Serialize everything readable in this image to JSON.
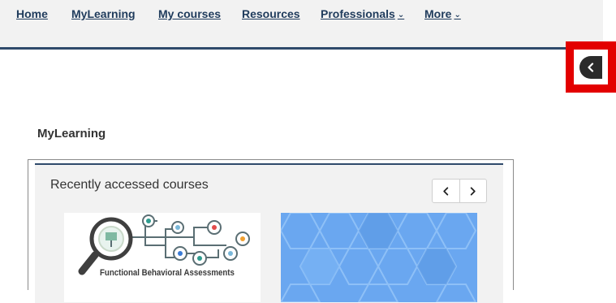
{
  "nav": {
    "home": "Home",
    "mylearning": "MyLearning",
    "mycourses": "My courses",
    "resources": "Resources",
    "professionals": "Professionals",
    "more": "More",
    "caret": "⌄"
  },
  "drawer_toggle": {
    "icon": "chevron-left-icon"
  },
  "section": {
    "heading": "MyLearning"
  },
  "recent": {
    "title": "Recently accessed courses",
    "prev_icon": "chevron-left-icon",
    "next_icon": "chevron-right-icon",
    "courses": [
      {
        "image_caption": "Functional Behavioral Assessments"
      },
      {
        "image_caption": ""
      }
    ]
  },
  "colors": {
    "nav_bg": "#f2f2f2",
    "nav_text": "#1f3b5c",
    "nav_border": "#2f4a6b",
    "highlight": "#e30000",
    "hex_pattern": "#6aa7f0"
  }
}
